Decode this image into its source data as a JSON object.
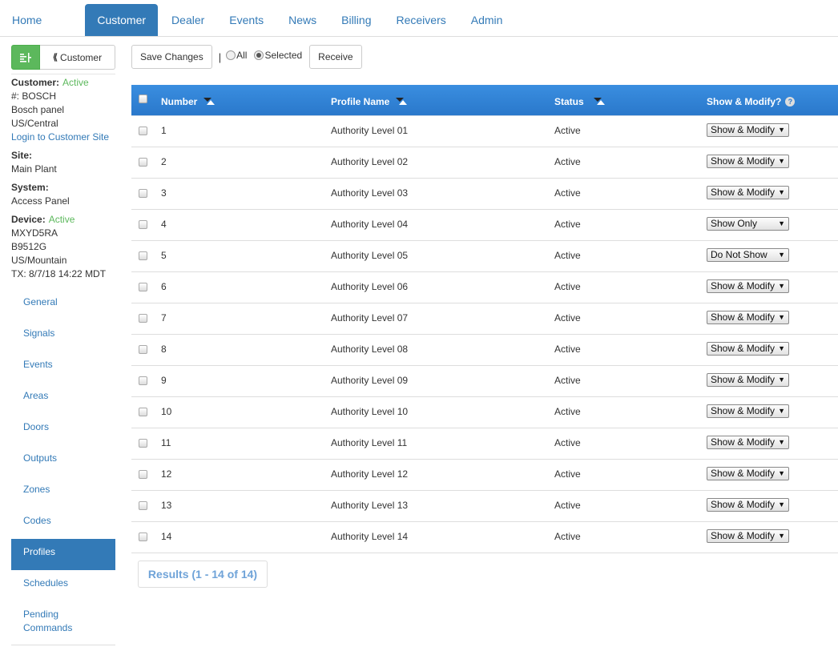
{
  "nav": {
    "items": [
      {
        "label": "Home",
        "name": "nav-home"
      },
      {
        "label": "Customer",
        "name": "nav-customer"
      },
      {
        "label": "Dealer",
        "name": "nav-dealer"
      },
      {
        "label": "Events",
        "name": "nav-events"
      },
      {
        "label": "News",
        "name": "nav-news"
      },
      {
        "label": "Billing",
        "name": "nav-billing"
      },
      {
        "label": "Receivers",
        "name": "nav-receivers"
      },
      {
        "label": "Admin",
        "name": "nav-admin"
      }
    ],
    "active": "Customer"
  },
  "sidebar": {
    "customer_button": "Customer",
    "customer_label": "Customer:",
    "customer_status": "Active",
    "customer_number": "#: BOSCH",
    "customer_name": "Bosch panel",
    "customer_tz": "US/Central",
    "login_link": "Login to Customer Site",
    "site_label": "Site:",
    "site_name": "Main Plant",
    "system_label": "System:",
    "system_name": "Access Panel",
    "device_label": "Device:",
    "device_status": "Active",
    "device_id": "MXYD5RA",
    "device_model": "B9512G",
    "device_tz": "US/Mountain",
    "device_tx": "TX: 8/7/18 14:22 MDT",
    "menu": [
      "General",
      "Signals",
      "Events",
      "Areas",
      "Doors",
      "Outputs",
      "Zones",
      "Codes",
      "Profiles",
      "Schedules",
      "Pending Commands"
    ],
    "menu_active": "Profiles"
  },
  "toolbar": {
    "save_label": "Save Changes",
    "separator": "|",
    "radio_all": "All",
    "radio_selected": "Selected",
    "selected_option": "Selected",
    "receive_label": "Receive"
  },
  "table": {
    "headers": {
      "number": "Number",
      "profile_name": "Profile Name",
      "status": "Status",
      "show_modify": "Show & Modify?"
    },
    "rows": [
      {
        "number": "1",
        "profile": "Authority Level 01",
        "status": "Active",
        "show": "Show & Modify"
      },
      {
        "number": "2",
        "profile": "Authority Level 02",
        "status": "Active",
        "show": "Show & Modify"
      },
      {
        "number": "3",
        "profile": "Authority Level 03",
        "status": "Active",
        "show": "Show & Modify"
      },
      {
        "number": "4",
        "profile": "Authority Level 04",
        "status": "Active",
        "show": "Show Only"
      },
      {
        "number": "5",
        "profile": "Authority Level 05",
        "status": "Active",
        "show": "Do Not Show"
      },
      {
        "number": "6",
        "profile": "Authority Level 06",
        "status": "Active",
        "show": "Show & Modify"
      },
      {
        "number": "7",
        "profile": "Authority Level 07",
        "status": "Active",
        "show": "Show & Modify"
      },
      {
        "number": "8",
        "profile": "Authority Level 08",
        "status": "Active",
        "show": "Show & Modify"
      },
      {
        "number": "9",
        "profile": "Authority Level 09",
        "status": "Active",
        "show": "Show & Modify"
      },
      {
        "number": "10",
        "profile": "Authority Level 10",
        "status": "Active",
        "show": "Show & Modify"
      },
      {
        "number": "11",
        "profile": "Authority Level 11",
        "status": "Active",
        "show": "Show & Modify"
      },
      {
        "number": "12",
        "profile": "Authority Level 12",
        "status": "Active",
        "show": "Show & Modify"
      },
      {
        "number": "13",
        "profile": "Authority Level 13",
        "status": "Active",
        "show": "Show & Modify"
      },
      {
        "number": "14",
        "profile": "Authority Level 14",
        "status": "Active",
        "show": "Show & Modify"
      }
    ]
  },
  "results": "Results (1 - 14 of 14)",
  "colors": {
    "primary": "#337ab7",
    "header_blue": "#2a78cb",
    "active_green": "#5cb85c"
  },
  "icons": {
    "left_button": "panel-layout-icon",
    "customer_button": "double-chevron-left-icon",
    "help": "question-circle-icon"
  }
}
